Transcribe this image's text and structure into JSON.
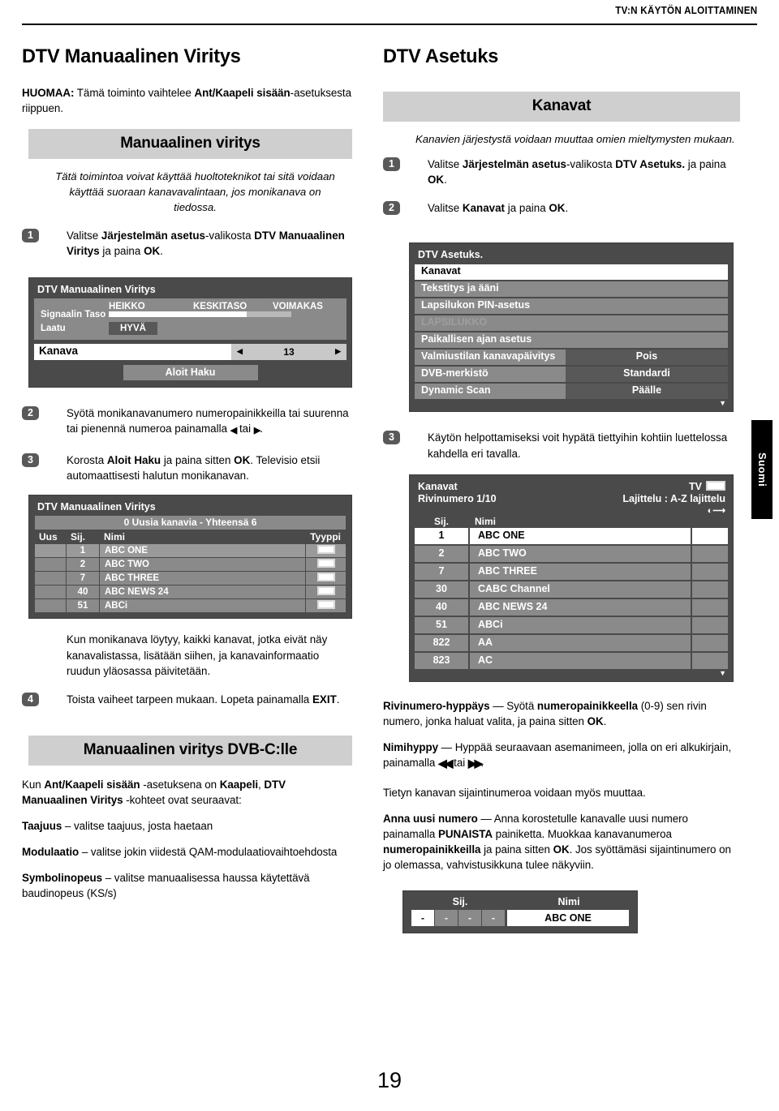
{
  "running_head": "TV:N KÄYTÖN ALOITTAMINEN",
  "page_number": "19",
  "side_tab": "Suomi",
  "left": {
    "title": "DTV Manuaalinen Viritys",
    "note_label": "HUOMAA:",
    "note_text_1": " Tämä toiminto vaihtelee ",
    "note_bold": "Ant/Kaapeli sisään",
    "note_text_2": "-asetuksesta riippuen.",
    "banner": "Manuaalinen viritys",
    "intro": "Tätä toimintoa voivat käyttää huoltoteknikot tai sitä voidaan käyttää suoraan kanavavalintaan, jos monikanava on tiedossa.",
    "step1_num": "1",
    "step1_a": "Valitse ",
    "step1_b1": "Järjestelmän asetus",
    "step1_c": "-valikosta ",
    "step1_b2": "DTV Manuaalinen Viritys",
    "step1_d": " ja paina ",
    "step1_b3": "OK",
    "step1_e": ".",
    "step2_num": "2",
    "step2_a": "Syötä monikanavanumero numeropainikkeilla tai suurenna tai pienennä numeroa painamalla ",
    "step2_arrow_left": "◀",
    "step2_mid": " tai ",
    "step2_arrow_right": "▶",
    "step2_end": ".",
    "step3_num": "3",
    "step3_a": "Korosta ",
    "step3_b1": "Aloit Haku",
    "step3_c": " ja paina sitten ",
    "step3_b2": "OK",
    "step3_d": ". Televisio etsii automaattisesti halutun monikanavan.",
    "after_found": "Kun monikanava löytyy, kaikki kanavat, jotka eivät näy kanavalistassa, lisätään siihen, ja kanavainformaatio ruudun yläosassa päivitetään.",
    "step4_num": "4",
    "step4_a": "Toista vaiheet tarpeen mukaan. Lopeta painamalla ",
    "step4_b1": "EXIT",
    "step4_c": ".",
    "banner2": "Manuaalinen viritys DVB-C:lle",
    "dvbc_a": "Kun ",
    "dvbc_b1": "Ant/Kaapeli sisään",
    "dvbc_c": " -asetuksena on ",
    "dvbc_b2": "Kaapeli",
    "dvbc_d": ", ",
    "dvbc_b3": "DTV Manuaalinen Viritys",
    "dvbc_e": " -kohteet ovat seuraavat:",
    "item1_bold": "Taajuus",
    "item1_rest": " – valitse taajuus, josta haetaan",
    "item2_bold": "Modulaatio",
    "item2_rest": " – valitse jokin viidestä QAM-modulaatiovaihtoehdosta",
    "item3_bold": "Symbolinopeus",
    "item3_rest": " – valitse manuaalisessa haussa käytettävä baudinopeus (KS/s)"
  },
  "osd_manual": {
    "title": "DTV Manuaalinen Viritys",
    "signal_label": "Signaalin Taso",
    "scale_weak": "HEIKKO",
    "scale_mid": "KESKITASO",
    "scale_strong": "VOIMAKAS",
    "quality_label": "Laatu",
    "quality_value": "HYVÄ",
    "channel_label": "Kanava",
    "channel_value": "13",
    "left_arrow": "◀",
    "right_arrow": "▶",
    "start_search": "Aloit Haku",
    "signal_fill_pct": 69,
    "signal_track_pct": 91
  },
  "osd_found": {
    "title": "DTV Manuaalinen Viritys",
    "subtitle": "0 Uusia kanavia - Yhteensä 6",
    "columns": [
      "Uus",
      "Sij.",
      "Nimi",
      "Tyyppi"
    ],
    "rows": [
      {
        "uus": "",
        "sij": "1",
        "nimi": "ABC ONE",
        "tyyppi": "tv-icon"
      },
      {
        "uus": "",
        "sij": "2",
        "nimi": "ABC TWO",
        "tyyppi": "tv-icon"
      },
      {
        "uus": "",
        "sij": "7",
        "nimi": "ABC THREE",
        "tyyppi": "tv-icon"
      },
      {
        "uus": "",
        "sij": "40",
        "nimi": "ABC NEWS 24",
        "tyyppi": "tv-icon"
      },
      {
        "uus": "",
        "sij": "51",
        "nimi": "ABCi",
        "tyyppi": "tv-icon"
      }
    ]
  },
  "right": {
    "title": "DTV Asetuks",
    "banner": "Kanavat",
    "intro": "Kanavien järjestystä voidaan muuttaa omien mieltymysten mukaan.",
    "step1_num": "1",
    "step1_a": "Valitse ",
    "step1_b1": "Järjestelmän asetus",
    "step1_c": "-valikosta ",
    "step1_b2": "DTV Asetuks.",
    "step1_d": " ja paina ",
    "step1_b3": "OK",
    "step1_e": ".",
    "step2_num": "2",
    "step2_a": "Valitse ",
    "step2_b1": "Kanavat",
    "step2_c": " ja paina ",
    "step2_b2": "OK",
    "step2_d": ".",
    "step3_num": "3",
    "step3_text": "Käytön helpottamiseksi voit hypätä tiettyihin kohtiin luettelossa kahdella eri tavalla.",
    "p1_bold": "Rivinumero-hyppäys",
    "p1_a": " — Syötä ",
    "p1_b1": "numeropainikkeella",
    "p1_b": " (0-9) sen rivin numero, jonka haluat valita, ja paina sitten ",
    "p1_b2": "OK",
    "p1_c": ".",
    "p2_bold": "Nimihyppy",
    "p2_a": " — Hyppää seuraavaan asemanimeen, jolla on eri alkukirjain, painamalla ",
    "p2_arrow_l": "◀◀",
    "p2_mid": " tai ",
    "p2_arrow_r": "▶▶",
    "p2_end": ".",
    "p3": "Tietyn kanavan sijaintinumeroa voidaan myös muuttaa.",
    "p4_bold": "Anna uusi numero",
    "p4_a": " — Anna korostetulle kanavalle uusi numero painamalla ",
    "p4_b1": "PUNAISTA",
    "p4_b": " painiketta. Muokkaa kanavanumeroa ",
    "p4_b2": "numeropainikkeilla",
    "p4_c": " ja paina sitten ",
    "p4_b3": "OK",
    "p4_d": ". Jos syöttämäsi sijaintinumero on jo olemassa, vahvistusikkuna tulee näkyviin."
  },
  "osd_menu": {
    "title": "DTV Asetuks.",
    "items": [
      {
        "label": "Kanavat",
        "value": "",
        "state": "selected"
      },
      {
        "label": "Tekstitys ja ääni",
        "value": "",
        "state": "normal"
      },
      {
        "label": "Lapsilukon PIN-asetus",
        "value": "",
        "state": "normal"
      },
      {
        "label": "LAPSILUKKO",
        "value": "",
        "state": "dimmed"
      },
      {
        "label": "Paikallisen ajan asetus",
        "value": "",
        "state": "normal"
      },
      {
        "label": "Valmiustilan kanavapäivitys",
        "value": "Pois",
        "state": "split"
      },
      {
        "label": "DVB-merkistö",
        "value": "Standardi",
        "state": "split"
      },
      {
        "label": "Dynamic Scan",
        "value": "Päälle",
        "state": "split"
      }
    ],
    "scroll_caret": "▼"
  },
  "osd_kanavat": {
    "title": "Kanavat",
    "rowcount": "Rivinumero 1/10",
    "mode_label": "TV",
    "sort_label": "Lajittelu : A-Z lajittelu",
    "col_sij": "Sij.",
    "col_nimi": "Nimi",
    "scroll_caret": "▼",
    "rows": [
      {
        "sij": "1",
        "nimi": "ABC ONE",
        "selected": true
      },
      {
        "sij": "2",
        "nimi": "ABC TWO",
        "selected": false
      },
      {
        "sij": "7",
        "nimi": "ABC THREE",
        "selected": false
      },
      {
        "sij": "30",
        "nimi": "CABC Channel",
        "selected": false
      },
      {
        "sij": "40",
        "nimi": "ABC NEWS 24",
        "selected": false
      },
      {
        "sij": "51",
        "nimi": "ABCi",
        "selected": false
      },
      {
        "sij": "822",
        "nimi": "AA",
        "selected": false
      },
      {
        "sij": "823",
        "nimi": "AC",
        "selected": false
      }
    ]
  },
  "osd_entry": {
    "col_sij": "Sij.",
    "col_nimi": "Nimi",
    "digits": [
      "-",
      "-",
      "-",
      "-"
    ],
    "name": "ABC ONE"
  },
  "colors": {
    "banner_gray": "#cfcfcf",
    "osd_bg": "#4a4a4a",
    "osd_row": "#8a8a8a",
    "osd_value": "#585858",
    "selected": "#ffffff",
    "black": "#000000"
  }
}
